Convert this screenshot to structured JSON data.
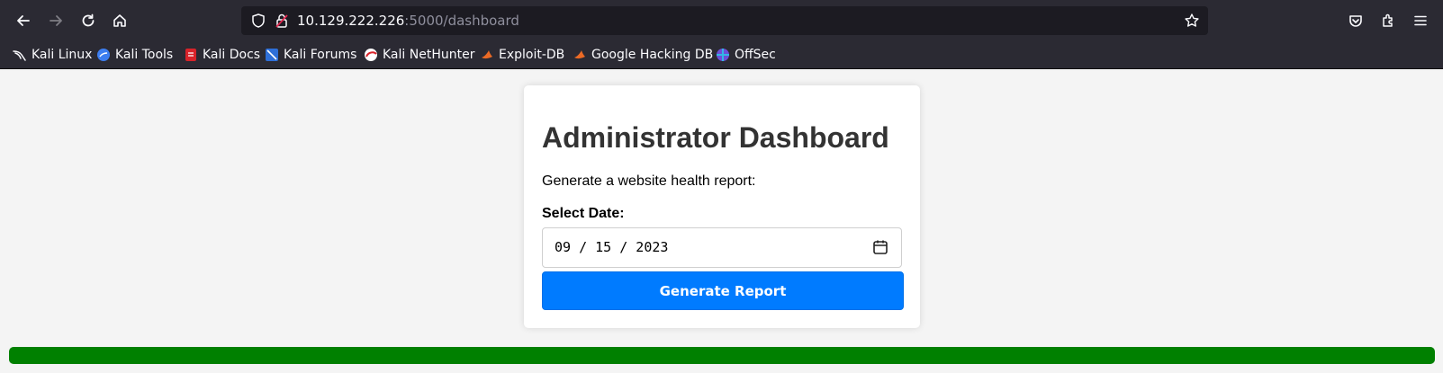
{
  "browser": {
    "url_host": "10.129.222.226",
    "url_path": ":5000/dashboard"
  },
  "bookmarks": [
    {
      "label": "Kali Linux"
    },
    {
      "label": "Kali Tools"
    },
    {
      "label": "Kali Docs"
    },
    {
      "label": "Kali Forums"
    },
    {
      "label": "Kali NetHunter"
    },
    {
      "label": "Exploit-DB"
    },
    {
      "label": "Google Hacking DB"
    },
    {
      "label": "OffSec"
    }
  ],
  "page": {
    "title": "Administrator Dashboard",
    "description": "Generate a website health report:",
    "date_label": "Select Date:",
    "date_value": "09 / 15 / 2023",
    "button_label": "Generate Report"
  },
  "colors": {
    "primary_button": "#007bff",
    "status_bar": "#008000"
  }
}
